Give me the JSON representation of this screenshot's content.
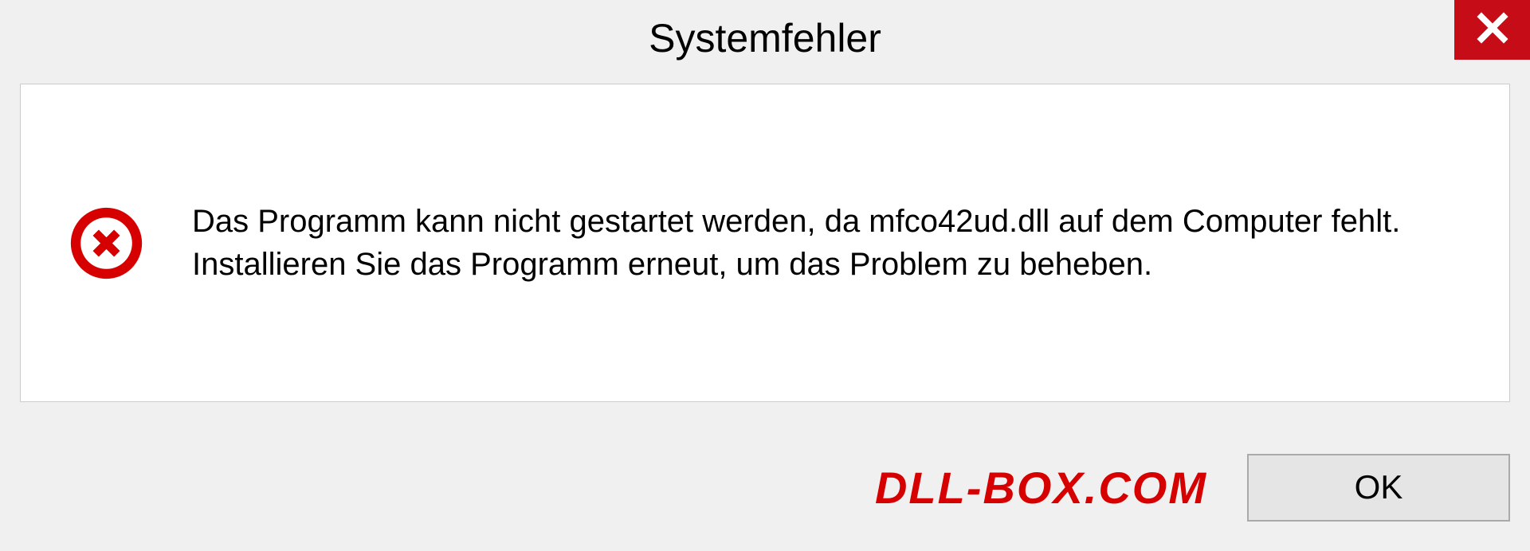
{
  "dialog": {
    "title": "Systemfehler",
    "message": "Das Programm kann nicht gestartet werden, da mfco42ud.dll auf dem Computer fehlt. Installieren Sie das Programm erneut, um das Problem zu beheben.",
    "ok_label": "OK"
  },
  "branding": {
    "text": "DLL-BOX.COM"
  }
}
